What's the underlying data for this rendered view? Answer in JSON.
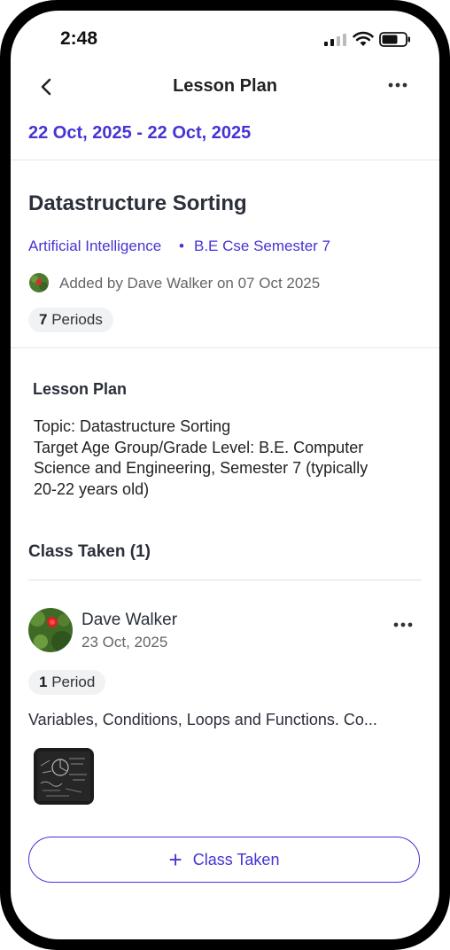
{
  "status_bar": {
    "time": "2:48"
  },
  "header": {
    "title": "Lesson Plan"
  },
  "date_range": "22 Oct, 2025 - 22 Oct, 2025",
  "plan": {
    "title": "Datastructure Sorting",
    "subject": "Artificial Intelligence",
    "separator": "•",
    "semester": "B.E Cse Semester 7",
    "added_by": "Added by Dave Walker on 07 Oct 2025",
    "periods_count": "7",
    "periods_label": "Periods"
  },
  "lesson_plan": {
    "heading": "Lesson Plan",
    "lines": [
      "Topic: Datastructure Sorting",
      "Target Age Group/Grade Level: B.E. Computer",
      "Science and Engineering, Semester 7 (typically",
      "20-22 years old)"
    ]
  },
  "class_taken": {
    "heading": "Class Taken (1)",
    "entries": [
      {
        "teacher": "Dave Walker",
        "date": "23 Oct, 2025",
        "periods_count": "1",
        "periods_label": "Period",
        "description": "Variables, Conditions, Loops and Functions. Co..."
      }
    ],
    "add_button_label": "Class Taken"
  },
  "icons": {
    "back": "chevron-left-icon",
    "more": "more-horizontal-icon",
    "plus": "plus-icon"
  },
  "colors": {
    "accent": "#4434d4"
  }
}
